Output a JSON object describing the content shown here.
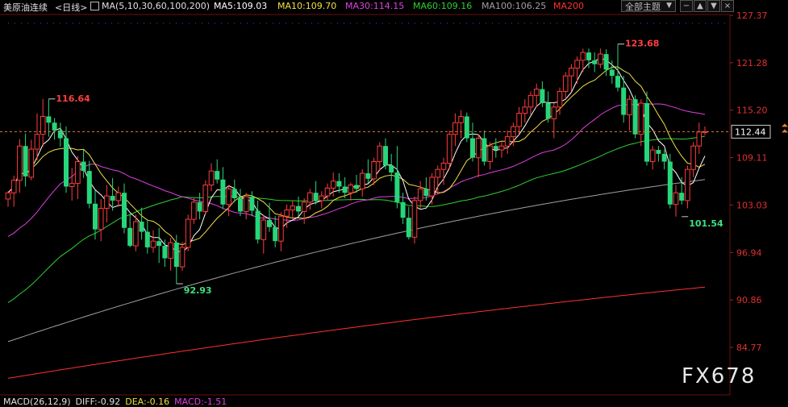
{
  "header": {
    "title": "美原油连续",
    "period": "<日线>",
    "ma_label": "MA(5,10,30,60,100,200)",
    "ma5": "MA5:109.03",
    "ma10": "MA10:109.70",
    "ma30": "MA30:114.15",
    "ma60": "MA60:109.16",
    "ma100": "MA100:106.25",
    "ma200": "MA200",
    "theme_button": "全部主题",
    "theme_arrow": "▼",
    "btn_minus": "−",
    "btn_up": "▲",
    "btn_down": "▼",
    "btn_close": "×"
  },
  "macd": {
    "label": "MACD(26,12,9)",
    "diff": "DIFF:-0.92",
    "dea": "DEA:-0.16",
    "macd": "MACD:-1.51"
  },
  "watermark": "FX678",
  "colors": {
    "up": "#ff3b3b",
    "down": "#27d67a",
    "ma5": "#ffffff",
    "ma10": "#f0e040",
    "ma30": "#e040e0",
    "ma60": "#30d030",
    "ma100": "#a0a0a0",
    "ma200": "#ff3030",
    "axis_text": "#e03030",
    "current_price_line": "#e08030"
  },
  "chart_data": {
    "type": "candlestick",
    "y_ticks": [
      "127.37",
      "121.28",
      "115.20",
      "109.11",
      "103.03",
      "96.94",
      "90.86",
      "84.77"
    ],
    "ylim": [
      84.77,
      127.37
    ],
    "current_price": "112.44",
    "annotations": [
      {
        "text": "116.64",
        "index": 7,
        "value": 116.64,
        "kind": "high"
      },
      {
        "text": "92.93",
        "index": 29,
        "value": 92.93,
        "kind": "low"
      },
      {
        "text": "123.68",
        "index": 105,
        "value": 123.68,
        "kind": "high"
      },
      {
        "text": "101.54",
        "index": 116,
        "value": 101.54,
        "kind": "low"
      }
    ],
    "candles": [
      [
        103.8,
        104.8,
        102.8,
        104.6
      ],
      [
        104.6,
        106.8,
        102.8,
        106.2
      ],
      [
        106.2,
        111.5,
        104.6,
        110.6
      ],
      [
        110.6,
        112.2,
        105.4,
        106.7
      ],
      [
        106.6,
        111.4,
        106.2,
        110.2
      ],
      [
        110.2,
        114.8,
        108.8,
        112.1
      ],
      [
        112.1,
        116.64,
        110.5,
        114.4
      ],
      [
        114.4,
        116.64,
        111.8,
        113.6
      ],
      [
        113.6,
        114.2,
        111.4,
        112.6
      ],
      [
        112.6,
        113.6,
        110.5,
        111.6
      ],
      [
        111.6,
        113.1,
        104.6,
        105.4
      ],
      [
        105.4,
        107.8,
        103.6,
        105.8
      ],
      [
        105.8,
        109.3,
        103.8,
        108.6
      ],
      [
        108.6,
        110.1,
        106.5,
        107.4
      ],
      [
        107.4,
        108.7,
        102.6,
        103.2
      ],
      [
        103.2,
        104.9,
        98.6,
        99.9
      ],
      [
        99.9,
        103.8,
        98.4,
        102.6
      ],
      [
        102.6,
        105.6,
        100.8,
        104.2
      ],
      [
        104.2,
        106.5,
        102.3,
        103.6
      ],
      [
        103.6,
        105.4,
        102.8,
        104.6
      ],
      [
        104.6,
        105.8,
        99.4,
        100.1
      ],
      [
        100.1,
        101.9,
        97.6,
        97.8
      ],
      [
        97.8,
        101.8,
        97.1,
        100.9
      ],
      [
        100.9,
        102.7,
        98.6,
        99.6
      ],
      [
        99.6,
        101.2,
        96.8,
        97.6
      ],
      [
        97.6,
        99.8,
        96.9,
        98.4
      ],
      [
        98.4,
        100.1,
        95.6,
        97.8
      ],
      [
        97.8,
        98.6,
        95.1,
        96.2
      ],
      [
        96.2,
        98.8,
        94.6,
        98.2
      ],
      [
        98.2,
        99.2,
        92.93,
        95.1
      ],
      [
        95.1,
        98.3,
        94.6,
        97.6
      ],
      [
        97.6,
        101.8,
        97.1,
        101.2
      ],
      [
        101.2,
        103.9,
        100.6,
        103.4
      ],
      [
        103.4,
        104.6,
        101.2,
        102.2
      ],
      [
        102.2,
        106.2,
        101.8,
        105.6
      ],
      [
        105.6,
        108.4,
        104.8,
        107.4
      ],
      [
        107.4,
        108.9,
        105.8,
        106.3
      ],
      [
        106.3,
        107.9,
        102.6,
        103.1
      ],
      [
        103.1,
        105.6,
        101.6,
        105.1
      ],
      [
        105.1,
        106.3,
        103.4,
        103.9
      ],
      [
        103.9,
        105.1,
        101.6,
        102.2
      ],
      [
        102.2,
        104.6,
        101.2,
        104.1
      ],
      [
        104.1,
        104.8,
        101.6,
        102.3
      ],
      [
        102.3,
        103.6,
        98.1,
        98.6
      ],
      [
        98.6,
        101.8,
        96.8,
        101.1
      ],
      [
        101.1,
        103.3,
        99.6,
        100.2
      ],
      [
        100.2,
        101.6,
        97.6,
        98.4
      ],
      [
        98.4,
        102.1,
        97.1,
        101.6
      ],
      [
        101.6,
        103.1,
        100.1,
        102.4
      ],
      [
        102.4,
        103.6,
        101.2,
        102.9
      ],
      [
        102.9,
        104.1,
        101.6,
        102.2
      ],
      [
        102.2,
        103.9,
        100.6,
        103.4
      ],
      [
        103.4,
        105.1,
        102.4,
        104.6
      ],
      [
        104.6,
        106.1,
        103.1,
        103.6
      ],
      [
        103.6,
        104.8,
        102.6,
        104.2
      ],
      [
        104.2,
        105.8,
        103.6,
        105.2
      ],
      [
        105.2,
        107.2,
        104.1,
        106.1
      ],
      [
        106.1,
        107.1,
        104.6,
        105.4
      ],
      [
        105.4,
        106.6,
        103.9,
        104.6
      ],
      [
        104.6,
        105.9,
        103.6,
        105.6
      ],
      [
        105.6,
        106.9,
        104.6,
        105.1
      ],
      [
        105.1,
        107.6,
        104.1,
        107.1
      ],
      [
        107.1,
        108.9,
        105.8,
        106.4
      ],
      [
        106.4,
        109.1,
        105.6,
        108.6
      ],
      [
        108.6,
        111.1,
        107.4,
        110.6
      ],
      [
        110.6,
        111.6,
        107.6,
        108.1
      ],
      [
        108.1,
        109.6,
        106.1,
        107.2
      ],
      [
        107.2,
        110.6,
        102.6,
        103.4
      ],
      [
        103.4,
        104.6,
        100.6,
        101.4
      ],
      [
        101.4,
        102.8,
        98.6,
        98.9
      ],
      [
        98.9,
        104.1,
        98.1,
        103.6
      ],
      [
        103.6,
        106.1,
        102.6,
        105.1
      ],
      [
        105.1,
        106.6,
        103.6,
        104.2
      ],
      [
        104.2,
        107.1,
        103.1,
        106.6
      ],
      [
        106.6,
        108.1,
        104.6,
        107.6
      ],
      [
        107.6,
        109.1,
        105.6,
        108.4
      ],
      [
        108.4,
        112.6,
        107.6,
        112.1
      ],
      [
        112.1,
        114.8,
        110.6,
        113.6
      ],
      [
        113.6,
        115.2,
        111.6,
        114.4
      ],
      [
        114.4,
        114.9,
        111.1,
        111.6
      ],
      [
        111.6,
        113.6,
        108.6,
        109.1
      ],
      [
        109.1,
        112.1,
        106.6,
        111.6
      ],
      [
        111.6,
        112.6,
        108.1,
        108.6
      ],
      [
        108.6,
        111.1,
        107.6,
        110.6
      ],
      [
        110.6,
        111.6,
        109.1,
        110.1
      ],
      [
        110.1,
        111.1,
        109.1,
        110.6
      ],
      [
        110.6,
        112.6,
        109.6,
        111.8
      ],
      [
        111.8,
        113.6,
        110.6,
        113.1
      ],
      [
        113.1,
        115.6,
        112.1,
        114.8
      ],
      [
        114.8,
        116.6,
        113.6,
        115.6
      ],
      [
        115.6,
        117.6,
        114.6,
        117.1
      ],
      [
        117.1,
        118.6,
        115.6,
        117.9
      ],
      [
        117.9,
        118.9,
        115.6,
        116.1
      ],
      [
        116.1,
        117.6,
        113.6,
        114.1
      ],
      [
        114.1,
        116.1,
        111.6,
        115.6
      ],
      [
        115.6,
        118.1,
        114.6,
        117.6
      ],
      [
        117.6,
        120.1,
        116.6,
        119.6
      ],
      [
        119.6,
        121.1,
        117.6,
        120.6
      ],
      [
        120.6,
        122.1,
        118.6,
        121.6
      ],
      [
        121.6,
        123.1,
        120.1,
        122.6
      ],
      [
        122.6,
        123.1,
        120.6,
        121.6
      ],
      [
        121.6,
        122.6,
        120.1,
        121.1
      ],
      [
        121.1,
        123.1,
        120.6,
        122.4
      ],
      [
        122.4,
        123.0,
        119.6,
        120.4
      ],
      [
        120.4,
        121.6,
        118.6,
        119.6
      ],
      [
        119.6,
        123.68,
        117.6,
        118.1
      ],
      [
        118.1,
        119.6,
        113.6,
        114.6
      ],
      [
        114.6,
        117.1,
        112.6,
        116.6
      ],
      [
        116.6,
        117.1,
        111.6,
        112.1
      ],
      [
        112.1,
        116.6,
        110.6,
        116.1
      ],
      [
        116.1,
        117.6,
        108.1,
        108.6
      ],
      [
        108.6,
        110.6,
        107.6,
        110.1
      ],
      [
        110.1,
        110.6,
        108.6,
        109.6
      ],
      [
        109.6,
        110.1,
        107.6,
        108.6
      ],
      [
        108.6,
        109.6,
        102.6,
        103.1
      ],
      [
        103.1,
        105.6,
        101.54,
        104.6
      ],
      [
        104.6,
        106.6,
        103.1,
        103.6
      ],
      [
        103.6,
        108.1,
        102.6,
        107.6
      ],
      [
        107.6,
        111.1,
        106.6,
        110.6
      ],
      [
        110.6,
        113.6,
        109.6,
        112.4
      ],
      [
        112.4,
        113.1,
        112.0,
        112.44
      ]
    ],
    "ma_series": {
      "MA5": "white",
      "MA10": "yellow",
      "MA30": "magenta",
      "MA60": "green",
      "MA100": "gray",
      "MA200": "red"
    }
  }
}
